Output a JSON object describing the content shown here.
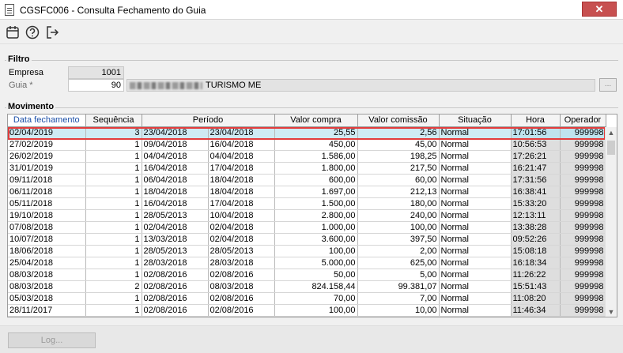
{
  "window": {
    "title": "CGSFC006 - Consulta Fechamento do Guia",
    "close_label": "✕"
  },
  "toolbar": {
    "icons": [
      "calendar-icon",
      "help-icon",
      "exit-icon"
    ]
  },
  "filtro": {
    "legend": "Filtro",
    "empresa_label": "Empresa",
    "empresa_value": "1001",
    "guia_label": "Guia *",
    "guia_value": "90",
    "guia_name": "TURISMO ME",
    "lookup_label": "..."
  },
  "movimento": {
    "legend": "Movimento",
    "columns": [
      "Data fechamento",
      "Sequência",
      "Período",
      "Valor compra",
      "Valor comissão",
      "Situação",
      "Hora",
      "Operador"
    ],
    "rows": [
      [
        "02/04/2019",
        "3",
        "23/04/2018",
        "23/04/2018",
        "25,55",
        "2,56",
        "Normal",
        "17:01:56",
        "999998"
      ],
      [
        "27/02/2019",
        "1",
        "09/04/2018",
        "16/04/2018",
        "450,00",
        "45,00",
        "Normal",
        "10:56:53",
        "999998"
      ],
      [
        "26/02/2019",
        "1",
        "04/04/2018",
        "04/04/2018",
        "1.586,00",
        "198,25",
        "Normal",
        "17:26:21",
        "999998"
      ],
      [
        "31/01/2019",
        "1",
        "16/04/2018",
        "17/04/2018",
        "1.800,00",
        "217,50",
        "Normal",
        "16:21:47",
        "999998"
      ],
      [
        "09/11/2018",
        "1",
        "06/04/2018",
        "18/04/2018",
        "600,00",
        "60,00",
        "Normal",
        "17:31:56",
        "999998"
      ],
      [
        "06/11/2018",
        "1",
        "18/04/2018",
        "18/04/2018",
        "1.697,00",
        "212,13",
        "Normal",
        "16:38:41",
        "999998"
      ],
      [
        "05/11/2018",
        "1",
        "16/04/2018",
        "17/04/2018",
        "1.500,00",
        "180,00",
        "Normal",
        "15:33:20",
        "999998"
      ],
      [
        "19/10/2018",
        "1",
        "28/05/2013",
        "10/04/2018",
        "2.800,00",
        "240,00",
        "Normal",
        "12:13:11",
        "999998"
      ],
      [
        "07/08/2018",
        "1",
        "02/04/2018",
        "02/04/2018",
        "1.000,00",
        "100,00",
        "Normal",
        "13:38:28",
        "999998"
      ],
      [
        "10/07/2018",
        "1",
        "13/03/2018",
        "02/04/2018",
        "3.600,00",
        "397,50",
        "Normal",
        "09:52:26",
        "999998"
      ],
      [
        "18/06/2018",
        "1",
        "28/05/2013",
        "28/05/2013",
        "100,00",
        "2,00",
        "Normal",
        "15:08:18",
        "999998"
      ],
      [
        "25/04/2018",
        "1",
        "28/03/2018",
        "28/03/2018",
        "5.000,00",
        "625,00",
        "Normal",
        "16:18:34",
        "999998"
      ],
      [
        "08/03/2018",
        "1",
        "02/08/2016",
        "02/08/2016",
        "50,00",
        "5,00",
        "Normal",
        "11:26:22",
        "999998"
      ],
      [
        "08/03/2018",
        "2",
        "02/08/2016",
        "08/03/2018",
        "824.158,44",
        "99.381,07",
        "Normal",
        "15:51:43",
        "999998"
      ],
      [
        "05/03/2018",
        "1",
        "02/08/2016",
        "02/08/2016",
        "70,00",
        "7,00",
        "Normal",
        "11:08:20",
        "999998"
      ],
      [
        "28/11/2017",
        "1",
        "02/08/2016",
        "02/08/2016",
        "100,00",
        "10,00",
        "Normal",
        "11:46:34",
        "999998"
      ]
    ]
  },
  "footer": {
    "log_label": "Log..."
  }
}
